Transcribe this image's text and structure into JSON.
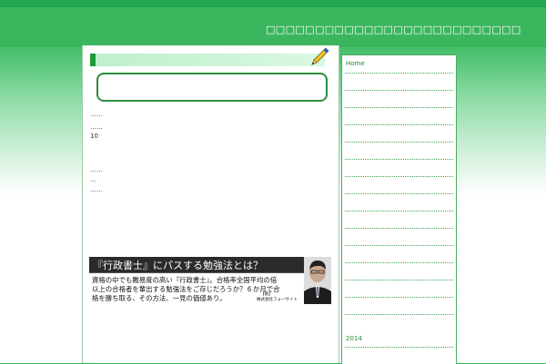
{
  "header": {
    "site_title": "□□□□□□□□□□□□□□□□□□□□□□□□□□"
  },
  "main": {
    "snippets": [
      "……",
      "……",
      "10",
      "……",
      "…",
      "……"
    ],
    "banner": {
      "title": "『行政書士』にパスする勉強法とは？",
      "lines": [
        "資格の中でも難易度の高い『行政書士』。合格率全国平均の倍",
        "以上の合格者を輩出する勉強法をご存じだろうか？６か月で合",
        "格を勝ち取る、その方法、一見の価値あり。"
      ],
      "author_tag": "【著】",
      "author_company": "株式会社フォーサイト"
    }
  },
  "sidebar": {
    "home_label": "Home",
    "year_label": "2014"
  },
  "colors": {
    "header_green": "#3cb65e",
    "accent_green": "#1d9a3a",
    "link_green": "#1f8a33"
  }
}
